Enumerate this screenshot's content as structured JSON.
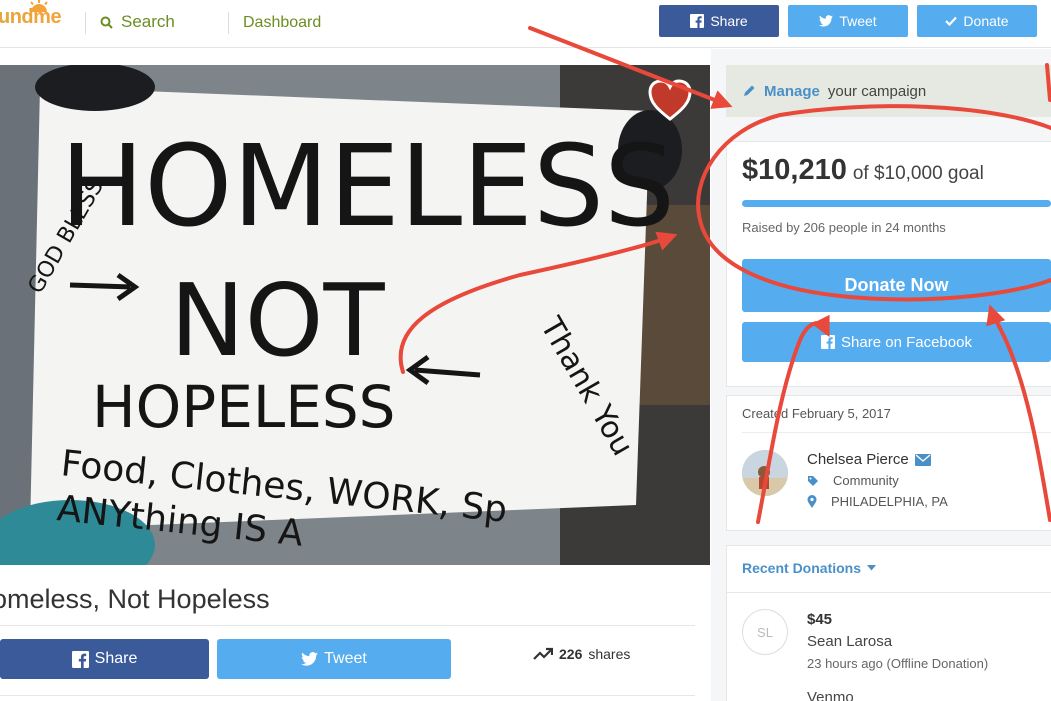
{
  "header": {
    "logo_text": "und",
    "logo_text_suffix": "me",
    "search_label": "Search",
    "dashboard_label": "Dashboard",
    "share_label": "Share",
    "tweet_label": "Tweet",
    "donate_label": "Donate"
  },
  "campaign": {
    "title": "omeless, Not Hopeless",
    "sign_lines": [
      "HOMELESS",
      "NOT",
      "HOPELESS",
      "Food, Clothes, WORK, Sp",
      "ANYthing IS A",
      "GOD BLESS",
      "Thank You"
    ],
    "share_label": "Share",
    "tweet_label": "Tweet",
    "shares_count": "226",
    "shares_label": "shares"
  },
  "sidebar": {
    "manage_link": "Manage",
    "manage_rest": "your campaign",
    "raised_amount": "$10,210",
    "goal_text": "of $10,000 goal",
    "progress_fraction": 1.0,
    "raised_by": "Raised by 206 people in 24 months",
    "donate_now": "Donate Now",
    "share_facebook": "Share on Facebook",
    "created": "Created February 5, 2017",
    "organizer_name": "Chelsea Pierce",
    "category": "Community",
    "location": "PHILADELPHIA, PA",
    "recent_donations": "Recent Donations",
    "donations": [
      {
        "initials": "SL",
        "amount": "$45",
        "name": "Sean Larosa",
        "time": "23 hours ago (Offline Donation)"
      }
    ],
    "next_donation_name": "Venmo"
  },
  "colors": {
    "facebook": "#3b5a9a",
    "twitter": "#55acee",
    "accent_link": "#4a90c8",
    "nav_green": "#6b8e23",
    "annotation_red": "#e8493a"
  }
}
